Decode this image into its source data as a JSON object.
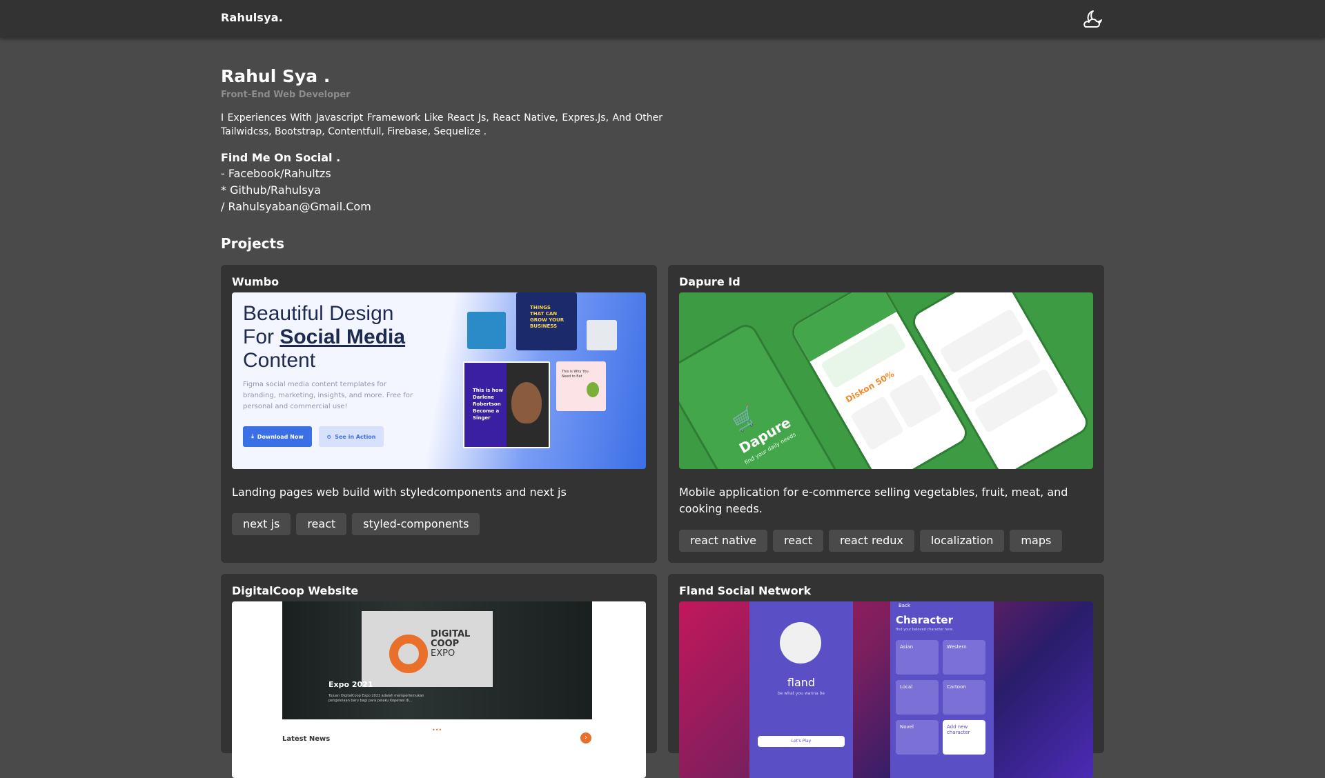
{
  "header": {
    "brand": "Rahulsya.",
    "theme_icon": "moon-cloud-icon"
  },
  "profile": {
    "name": "Rahul Sya .",
    "role": "Front-End Web Developer",
    "bio": "I Experiences With Javascript Framework Like React Js, React Native, Expres.Js, And Other Tailwidcss, Bootstrap, Contentfull, Firebase, Sequelize ."
  },
  "social": {
    "title": "Find Me On Social .",
    "links": [
      "- Facebook/Rahultzs",
      "* Github/Rahulsya",
      "/ Rahulsyaban@Gmail.Com"
    ]
  },
  "projects": {
    "title": "Projects",
    "items": [
      {
        "title": "Wumbo",
        "description": "Landing pages web build with styledcomponents and next js",
        "tags": [
          "next js",
          "react",
          "styled-components"
        ],
        "image": {
          "heading_line1": "Beautiful Design",
          "heading_line2_prefix": "For ",
          "heading_line2_link": "Social Media",
          "heading_line3": "Content",
          "body": "Figma social media content templates for branding, marketing, insights, and more. Free for personal and commercial use!",
          "download_btn": "Download Now",
          "action_btn": "See in Action",
          "card_text1": "THINGS THAT CAN GROW YOUR BUSINESS",
          "card_text2": "This is how Darlene Robertson Become a Singer",
          "card_text3": "This is Why You Need to Eat"
        }
      },
      {
        "title": "Dapure Id",
        "description": "Mobile application for e-commerce selling vegetables, fruit, meat, and cooking needs.",
        "tags": [
          "react native",
          "react",
          "react redux",
          "localization",
          "maps"
        ],
        "image": {
          "app_name": "Dapure",
          "tagline": "find your daily needs",
          "promo": "Diskon 50%"
        }
      },
      {
        "title": "DigitalCoop Website",
        "description": "",
        "tags": [],
        "image": {
          "logo_line1": "DIGITAL",
          "logo_line2": "COOP",
          "logo_line3": "EXPO",
          "event": "Expo 2021",
          "event_text": "Tujuan DigitalCoop Expo 2021 adalah mempertemukan pengelolaan baru bagi para pelaku Koperasi di...",
          "news": "Latest News"
        }
      },
      {
        "title": "Fland Social Network",
        "description": "",
        "tags": [],
        "image": {
          "app_name": "fland",
          "tagline": "be what you wanna be",
          "screen_title": "Character",
          "screen_sub": "find your beloved character here.",
          "tiles": [
            "Asian",
            "Western",
            "Local",
            "Cartoon",
            "Novel",
            "Add new character"
          ],
          "back": "Back",
          "btn": "Let's Play"
        }
      }
    ]
  },
  "colors": {
    "background": "#4a4a4a",
    "header": "#333333",
    "card": "#333333",
    "tag": "#4a4a4a",
    "muted_text": "#8d8d8d",
    "wumbo_accent": "#3b6fe6",
    "dapure_green": "#41a047",
    "coop_orange": "#e8702a",
    "fland_purple": "#5a4fc4"
  }
}
